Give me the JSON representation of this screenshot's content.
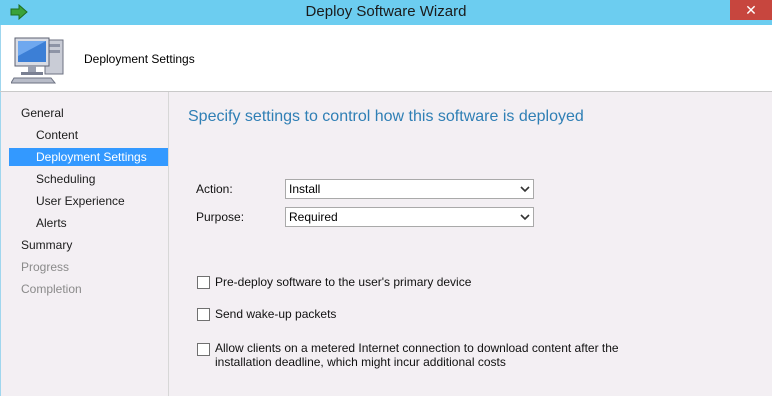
{
  "window": {
    "title": "Deploy Software Wizard",
    "close_glyph": "✕",
    "accent_color": "#6ccdf0",
    "app_icon": "green-arrow-icon"
  },
  "header": {
    "title": "Deployment Settings",
    "icon": "computer-icon"
  },
  "nav": {
    "items": [
      {
        "label": "General",
        "state": "normal",
        "level": 0
      },
      {
        "label": "Content",
        "state": "normal",
        "level": 1
      },
      {
        "label": "Deployment Settings",
        "state": "selected",
        "level": 1
      },
      {
        "label": "Scheduling",
        "state": "normal",
        "level": 1
      },
      {
        "label": "User Experience",
        "state": "normal",
        "level": 1
      },
      {
        "label": "Alerts",
        "state": "normal",
        "level": 1
      },
      {
        "label": "Summary",
        "state": "normal",
        "level": 0
      },
      {
        "label": "Progress",
        "state": "disabled",
        "level": 0
      },
      {
        "label": "Completion",
        "state": "disabled",
        "level": 0
      }
    ]
  },
  "main": {
    "heading": "Specify settings to control how this software is deployed",
    "action": {
      "label": "Action:",
      "value": "Install"
    },
    "purpose": {
      "label": "Purpose:",
      "value": "Required"
    },
    "checkboxes": [
      {
        "label": "Pre-deploy software to the user's primary device",
        "checked": false
      },
      {
        "label": "Send wake-up packets",
        "checked": false
      },
      {
        "label_line1": "Allow clients on a metered Internet connection to download content after the",
        "label_line2": "installation deadline, which might incur additional costs",
        "checked": false
      }
    ]
  }
}
